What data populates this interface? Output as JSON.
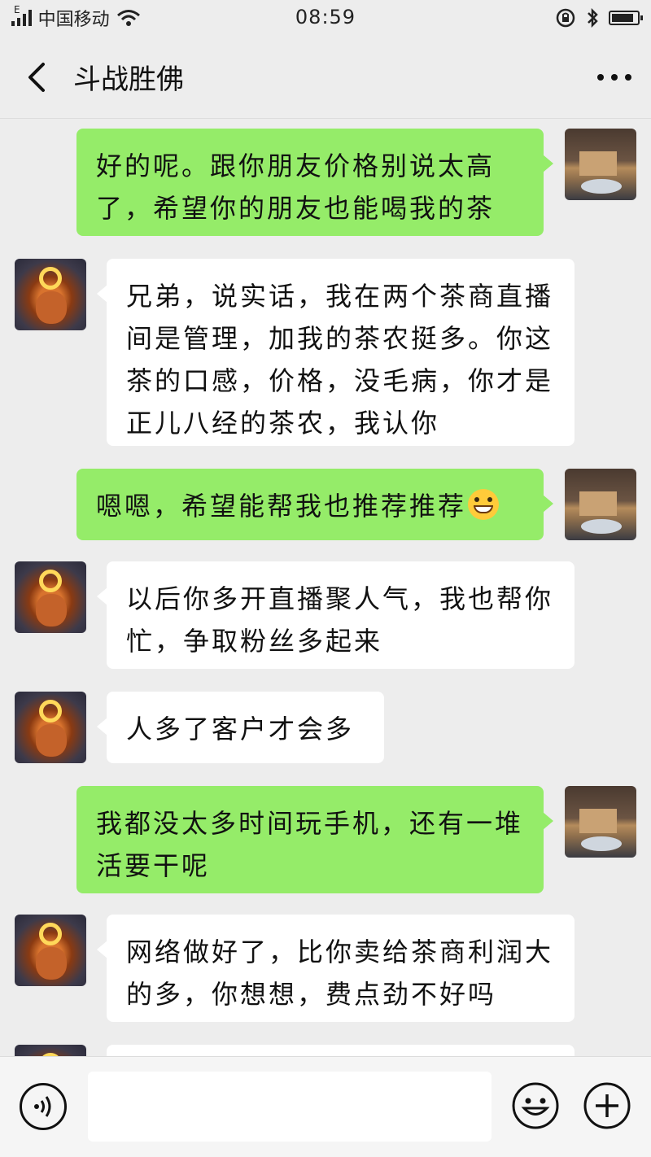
{
  "status_bar": {
    "carrier": "中国移动",
    "network": "E",
    "time": "08:59",
    "battery_level_pct": 85
  },
  "header": {
    "title": "斗战胜佛",
    "back_icon": "chevron-left-icon",
    "more_icon": "more-dots-icon"
  },
  "messages": [
    {
      "sender": "me",
      "text": "好的呢。跟你朋友价格别说太高了，希望你的朋友也能喝我的茶"
    },
    {
      "sender": "them",
      "text": "兄弟，说实话，我在两个茶商直播间是管理，加我的茶农挺多。你这茶的口感，价格，没毛病，你才是正儿八经的茶农，我认你"
    },
    {
      "sender": "me",
      "text": "嗯嗯，希望能帮我也推荐推荐",
      "emoji": "grin-emoji"
    },
    {
      "sender": "them",
      "text": "以后你多开直播聚人气，我也帮你忙，争取粉丝多起来"
    },
    {
      "sender": "them",
      "text": "人多了客户才会多"
    },
    {
      "sender": "me",
      "text": "我都没太多时间玩手机，还有一堆活要干呢"
    },
    {
      "sender": "them",
      "text": "网络做好了，比你卖给茶商利润大的多，你想想，费点劲不好吗"
    }
  ],
  "input_bar": {
    "voice_icon": "voice-icon",
    "emoji_icon": "emoji-icon",
    "plus_icon": "plus-icon",
    "input_value": ""
  },
  "colors": {
    "background": "#ededed",
    "my_bubble": "#95ec69",
    "their_bubble": "#ffffff"
  }
}
